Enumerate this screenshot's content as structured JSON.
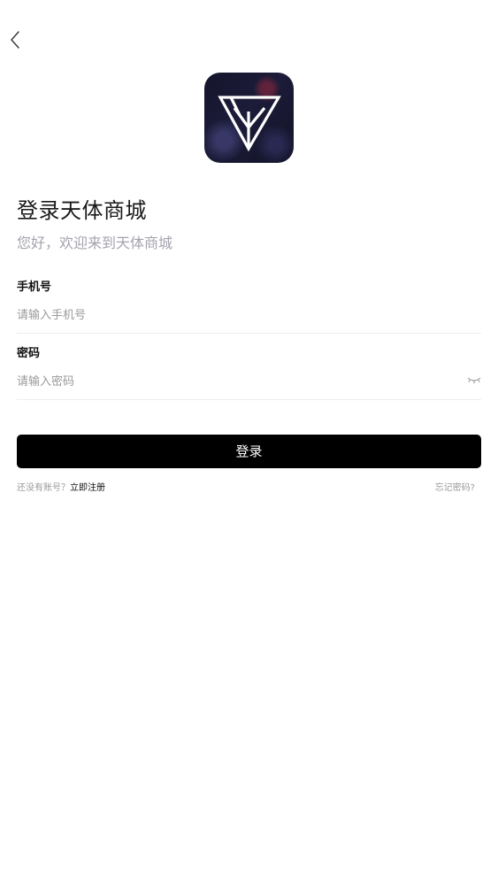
{
  "header": {
    "back_icon": "chevron-left-icon"
  },
  "brand": {
    "logo_icon": "tianti-triangle-logo",
    "logo_colors": [
      "#14142b",
      "#ffffff"
    ]
  },
  "login": {
    "title": "登录天体商城",
    "subtitle": "您好，欢迎来到天体商城",
    "phone": {
      "label": "手机号",
      "placeholder": "请输入手机号",
      "value": ""
    },
    "password": {
      "label": "密码",
      "placeholder": "请输入密码",
      "value": "",
      "toggle_icon": "eye-closed-icon"
    },
    "submit_label": "登录",
    "no_account_text": "还没有账号？",
    "register_label": "立即注册",
    "forgot_label": "忘记密码?"
  },
  "colors": {
    "primary_button": "#000000",
    "subtitle": "#a3a3ad",
    "placeholder": "#9a9a9a"
  }
}
